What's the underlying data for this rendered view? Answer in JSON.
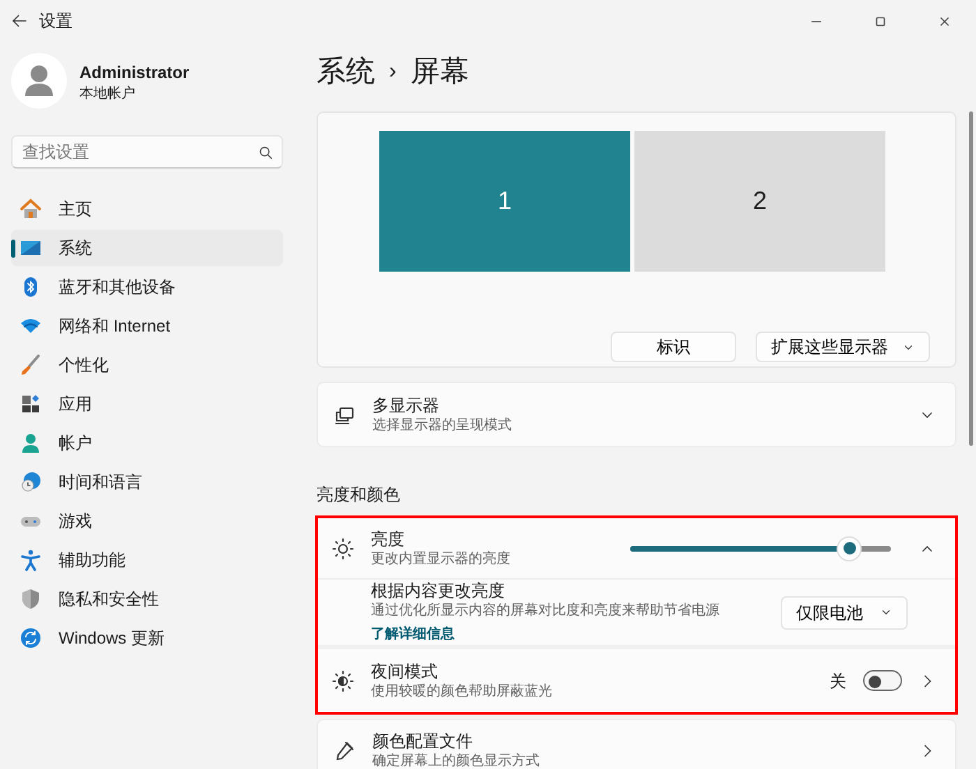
{
  "window": {
    "title": "设置"
  },
  "account": {
    "name": "Administrator",
    "type": "本地帐户"
  },
  "search": {
    "placeholder": "查找设置"
  },
  "nav": [
    {
      "label": "主页",
      "selected": false
    },
    {
      "label": "系统",
      "selected": true
    },
    {
      "label": "蓝牙和其他设备",
      "selected": false
    },
    {
      "label": "网络和 Internet",
      "selected": false
    },
    {
      "label": "个性化",
      "selected": false
    },
    {
      "label": "应用",
      "selected": false
    },
    {
      "label": "帐户",
      "selected": false
    },
    {
      "label": "时间和语言",
      "selected": false
    },
    {
      "label": "游戏",
      "selected": false
    },
    {
      "label": "辅助功能",
      "selected": false
    },
    {
      "label": "隐私和安全性",
      "selected": false
    },
    {
      "label": "Windows 更新",
      "selected": false
    }
  ],
  "breadcrumb": {
    "parent": "系统",
    "separator": "›",
    "current": "屏幕"
  },
  "displays": [
    {
      "label": "1",
      "selected": true
    },
    {
      "label": "2",
      "selected": false
    }
  ],
  "display_buttons": {
    "identify": "标识",
    "mode": "扩展这些显示器"
  },
  "multi_display": {
    "title": "多显示器",
    "subtitle": "选择显示器的呈现模式",
    "expanded": false
  },
  "section_heading": "亮度和颜色",
  "highlighted": true,
  "brightness": {
    "title": "亮度",
    "subtitle": "更改内置显示器的亮度",
    "level": 0.84,
    "expanded": true
  },
  "content_brightness": {
    "title": "根据内容更改亮度",
    "subtitle": "通过优化所显示内容的屏幕对比度和亮度来帮助节省电源",
    "link": "了解详细信息",
    "value": "仅限电池"
  },
  "night_light": {
    "title": "夜间模式",
    "subtitle": "使用较暖的颜色帮助屏蔽蓝光",
    "state_label": "关",
    "on": false
  },
  "color_profile": {
    "title": "颜色配置文件",
    "subtitle": "确定屏幕上的颜色显示方式"
  }
}
